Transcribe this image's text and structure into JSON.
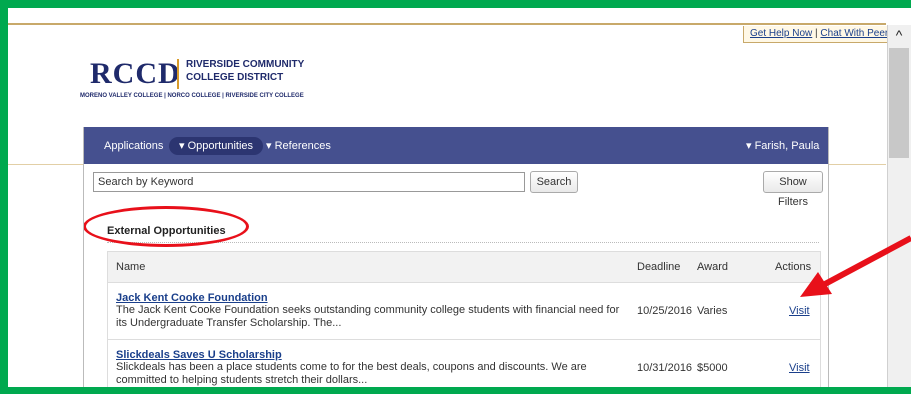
{
  "help": {
    "get_help": "Get Help Now",
    "separator": "|",
    "chat": "Chat With Peers"
  },
  "logo": {
    "acronym": "RCCD",
    "name_line1": "RIVERSIDE COMMUNITY",
    "name_line2": "COLLEGE DISTRICT",
    "colleges": "MORENO VALLEY COLLEGE | NORCO COLLEGE | RIVERSIDE CITY COLLEGE"
  },
  "nav": {
    "applications": "Applications",
    "opportunities": "▾ Opportunities",
    "references": "▾ References",
    "user": "▾ Farish, Paula"
  },
  "search": {
    "placeholder": "Search by Keyword",
    "button": "Search",
    "filters": "Show Filters"
  },
  "section": {
    "title": "External Opportunities"
  },
  "table": {
    "headers": {
      "name": "Name",
      "deadline": "Deadline",
      "award": "Award",
      "actions": "Actions"
    },
    "rows": [
      {
        "title": "Jack Kent Cooke Foundation",
        "description": "The Jack Kent Cooke Foundation seeks outstanding community college students with financial need for its Undergraduate Transfer Scholarship. The...",
        "deadline": "10/25/2016",
        "award": "Varies",
        "action": "Visit"
      },
      {
        "title": "Slickdeals Saves U Scholarship",
        "description": "Slickdeals has been a place students come to for the best deals, coupons and discounts. We are committed to helping students stretch their dollars...",
        "deadline": "10/31/2016",
        "award": "$5000",
        "action": "Visit"
      }
    ]
  },
  "colors": {
    "frame": "#00a94f",
    "navbar": "#45508f",
    "annotation": "#e8101a",
    "link": "#1a3f8b"
  }
}
